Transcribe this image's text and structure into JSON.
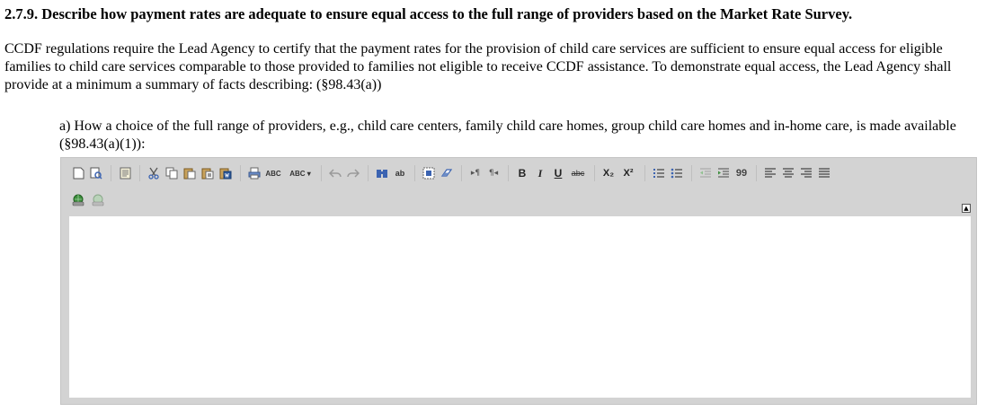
{
  "section": {
    "heading": "2.7.9. Describe how payment rates are adequate to ensure equal access to the full range of providers based on the Market Rate Survey.",
    "intro": "CCDF regulations require the Lead Agency to certify that the payment rates for the provision of child care services are sufficient to ensure equal access for eligible families to child care services comparable to those provided to families not eligible to receive CCDF assistance. To demonstrate equal access, the Lead Agency shall provide at a minimum a summary of facts describing: (§98.43(a))",
    "question": "a) How a choice of the full range of providers, e.g., child care centers, family child care homes, group child care homes and in-home care, is made available (§98.43(a)(1)):"
  },
  "editor": {
    "value": "",
    "toolbar": {
      "spellcheck_label": "ABC",
      "scayt_label": "ABC ▾",
      "find_label": "ab",
      "bold_label": "B",
      "italic_label": "I",
      "underline_label": "U",
      "strike_label": "abc",
      "subscript_label": "X₂",
      "superscript_label": "X²",
      "blockquote_label": "99"
    },
    "icons": {
      "new_page": "new-page-icon",
      "preview": "preview-icon",
      "templates": "templates-icon",
      "cut": "cut-icon",
      "copy": "copy-icon",
      "paste": "paste-icon",
      "paste_text": "paste-text-icon",
      "paste_word": "paste-word-icon",
      "print": "print-icon",
      "undo": "undo-icon",
      "redo": "redo-icon",
      "find": "find-icon",
      "replace": "replace-icon",
      "select_all": "select-all-icon",
      "remove_format": "remove-format-icon",
      "ltr": "ltr-icon",
      "rtl": "rtl-icon",
      "numbered_list": "numbered-list-icon",
      "bulleted_list": "bulleted-list-icon",
      "outdent": "outdent-icon",
      "indent": "indent-icon",
      "align_left": "align-left-icon",
      "align_center": "align-center-icon",
      "align_right": "align-right-icon",
      "justify": "justify-icon",
      "link": "link-icon",
      "unlink": "unlink-icon",
      "collapse": "collapse-toolbar-icon"
    }
  }
}
